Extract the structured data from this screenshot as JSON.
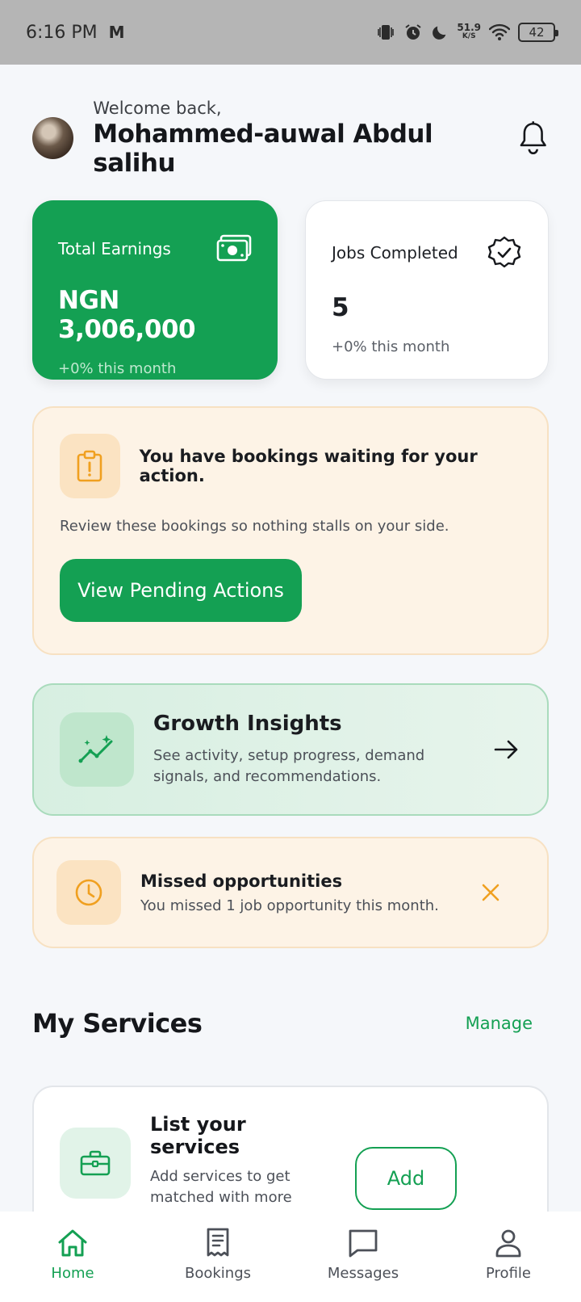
{
  "status_bar": {
    "time": "6:16 PM",
    "mail_icon": "M",
    "net_speed_value": "51.9",
    "net_speed_unit": "K/S",
    "battery": "42"
  },
  "header": {
    "welcome": "Welcome back,",
    "name": "Mohammed-auwal Abdul salihu"
  },
  "stats": {
    "earnings": {
      "title": "Total Earnings",
      "value": "NGN 3,006,000",
      "sub": "+0% this month"
    },
    "jobs": {
      "title": "Jobs Completed",
      "value": "5",
      "sub": "+0% this month"
    }
  },
  "pending": {
    "title": "You have bookings waiting for your action.",
    "desc": "Review these bookings so nothing stalls on your side.",
    "button": "View Pending Actions"
  },
  "growth": {
    "title": "Growth Insights",
    "desc": "See activity, setup progress, demand signals, and recommendations."
  },
  "missed": {
    "title": "Missed opportunities",
    "desc": "You missed 1 job opportunity this month."
  },
  "services": {
    "section_title": "My Services",
    "manage": "Manage",
    "card_title": "List your services",
    "card_desc": "Add services to get matched with more jobs.",
    "add_button": "Add"
  },
  "nav": {
    "home": "Home",
    "bookings": "Bookings",
    "messages": "Messages",
    "profile": "Profile"
  },
  "colors": {
    "primary": "#14a053",
    "warning": "#f0a020",
    "warning_bg": "#fdf3e6"
  }
}
